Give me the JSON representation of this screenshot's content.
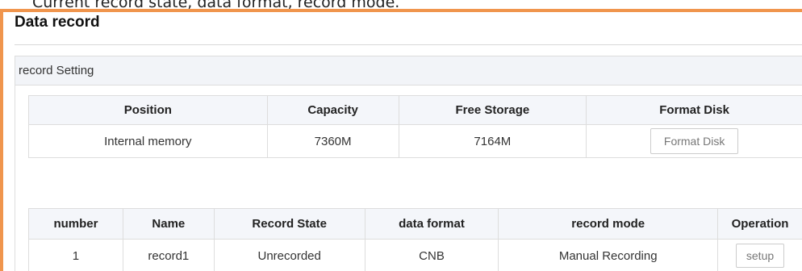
{
  "caption": "Current record state, data format, record mode.",
  "page": {
    "title": "Data record"
  },
  "section": {
    "title": "record Setting"
  },
  "storage_table": {
    "headers": [
      "Position",
      "Capacity",
      "Free Storage",
      "Format Disk"
    ],
    "rows": [
      {
        "position": "Internal memory",
        "capacity": "7360M",
        "free": "7164M",
        "action_label": "Format Disk"
      }
    ]
  },
  "record_table": {
    "headers": [
      "number",
      "Name",
      "Record State",
      "data format",
      "record mode",
      "Operation"
    ],
    "rows": [
      {
        "number": "1",
        "name": "record1",
        "state": "Unrecorded",
        "format": "CNB",
        "mode": "Manual Recording",
        "action_label": "setup"
      }
    ]
  },
  "colors": {
    "frame_accent": "#f0954d",
    "header_bg": "#f4f6fa",
    "border": "#dddddd"
  }
}
